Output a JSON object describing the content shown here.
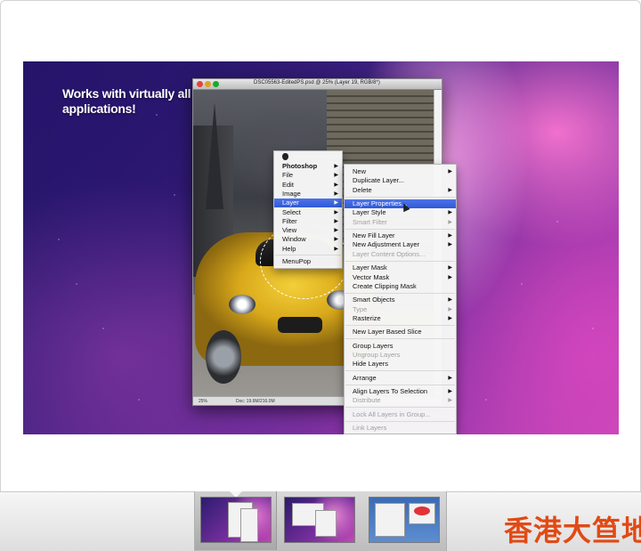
{
  "hero": {
    "headline": "Works with virtually all applications!"
  },
  "photoshop": {
    "title": "DSC05563-EditedPS.psd @ 25% (Layer 19, RGB/8*)",
    "zoom": "25%",
    "doc_size": "Doc: 19.6M/216.0M"
  },
  "main_menu": {
    "items": [
      {
        "label": "Photoshop",
        "bold": true
      },
      {
        "label": "File"
      },
      {
        "label": "Edit"
      },
      {
        "label": "Image"
      },
      {
        "label": "Layer",
        "highlighted": true
      },
      {
        "label": "Select"
      },
      {
        "label": "Filter"
      },
      {
        "label": "View"
      },
      {
        "label": "Window"
      },
      {
        "label": "Help"
      },
      {
        "label": "MenuPop"
      }
    ]
  },
  "layer_menu": {
    "items": [
      {
        "label": "New",
        "submenu": true
      },
      {
        "label": "Duplicate Layer..."
      },
      {
        "label": "Delete",
        "submenu": true
      },
      {
        "label": "Layer Properties...",
        "highlighted": true
      },
      {
        "label": "Layer Style",
        "submenu": true
      },
      {
        "label": "Smart Filter",
        "submenu": true,
        "disabled": true
      },
      {
        "label": "New Fill Layer",
        "submenu": true
      },
      {
        "label": "New Adjustment Layer",
        "submenu": true
      },
      {
        "label": "Layer Content Options...",
        "disabled": true
      },
      {
        "label": "Layer Mask",
        "submenu": true
      },
      {
        "label": "Vector Mask",
        "submenu": true
      },
      {
        "label": "Create Clipping Mask"
      },
      {
        "label": "Smart Objects",
        "submenu": true
      },
      {
        "label": "Type",
        "submenu": true,
        "disabled": true
      },
      {
        "label": "Rasterize",
        "submenu": true
      },
      {
        "label": "New Layer Based Slice"
      },
      {
        "label": "Group Layers"
      },
      {
        "label": "Ungroup Layers",
        "disabled": true
      },
      {
        "label": "Hide Layers"
      },
      {
        "label": "Arrange",
        "submenu": true
      },
      {
        "label": "Align Layers To Selection",
        "submenu": true
      },
      {
        "label": "Distribute",
        "submenu": true,
        "disabled": true
      },
      {
        "label": "Lock All Layers in Group...",
        "disabled": true
      },
      {
        "label": "Link Layers",
        "disabled": true
      }
    ]
  },
  "watermark": "香港大笪地",
  "colors": {
    "menu_highlight": "#3a63de",
    "watermark": "#e14a14"
  }
}
